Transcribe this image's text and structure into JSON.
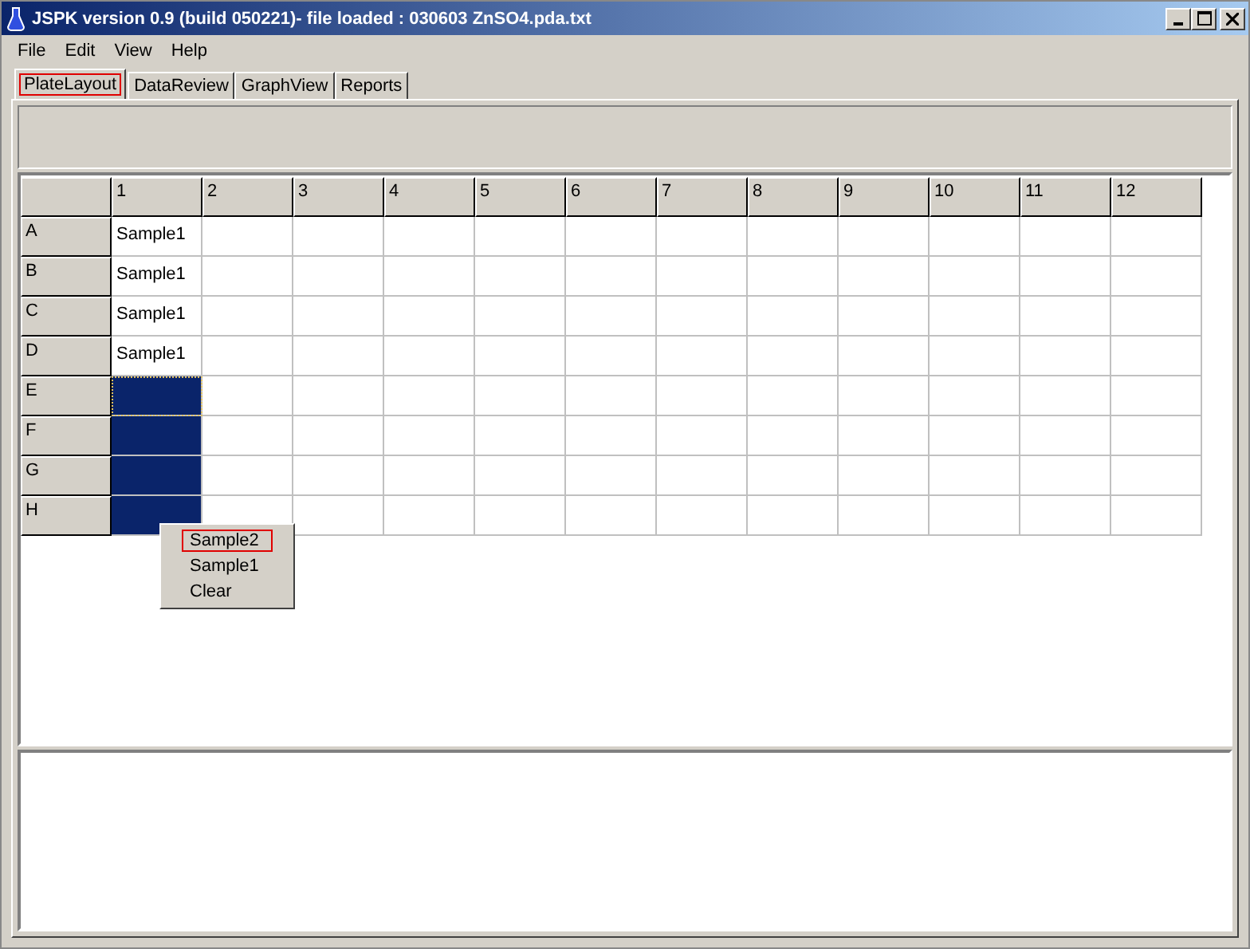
{
  "window": {
    "title": "JSPK version 0.9 (build 050221)- file loaded : 030603 ZnSO4.pda.txt"
  },
  "menu": [
    "File",
    "Edit",
    "View",
    "Help"
  ],
  "tabs": [
    {
      "label": "PlateLayout",
      "selected": true
    },
    {
      "label": "DataReview",
      "selected": false
    },
    {
      "label": "GraphView",
      "selected": false
    },
    {
      "label": "Reports",
      "selected": false
    }
  ],
  "columns": [
    "1",
    "2",
    "3",
    "4",
    "5",
    "6",
    "7",
    "8",
    "9",
    "10",
    "11",
    "12"
  ],
  "rows": [
    {
      "label": "A",
      "text": "Sample1",
      "selected": false,
      "focused": false
    },
    {
      "label": "B",
      "text": "Sample1",
      "selected": false,
      "focused": false
    },
    {
      "label": "C",
      "text": "Sample1",
      "selected": false,
      "focused": false
    },
    {
      "label": "D",
      "text": "Sample1",
      "selected": false,
      "focused": false
    },
    {
      "label": "E",
      "selected": true,
      "focused": true
    },
    {
      "label": "F",
      "selected": true,
      "focused": false
    },
    {
      "label": "G",
      "selected": true,
      "focused": false
    },
    {
      "label": "H",
      "selected": true,
      "focused": false
    }
  ],
  "context_menu": [
    {
      "label": "Sample2",
      "selected": true
    },
    {
      "label": "Sample1",
      "selected": false
    },
    {
      "label": "Clear",
      "selected": false
    }
  ]
}
